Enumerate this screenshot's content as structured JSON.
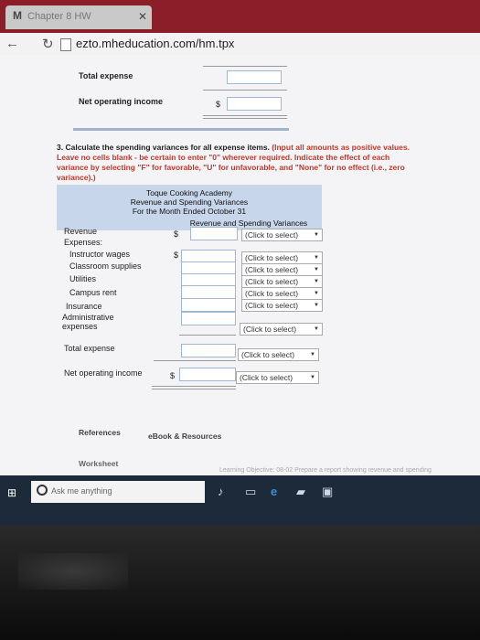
{
  "browser": {
    "tab_title": "Chapter 8 HW",
    "url": "ezto.mheducation.com/hm.tpx"
  },
  "top_section": {
    "total_expense_label": "Total expense",
    "net_operating_income_label": "Net operating income",
    "currency": "$"
  },
  "instructions": {
    "number": "3.",
    "text": "Calculate the spending variances for all expense items.",
    "note": "(Input all amounts as positive values. Leave no cells blank - be certain to enter \"0\" wherever required. Indicate the effect of each variance by selecting \"F\" for favorable, \"U\" for unfavorable, and \"None\" for no effect (i.e., zero variance).)"
  },
  "table": {
    "company": "Toque Cooking Academy",
    "report": "Revenue and Spending Variances",
    "period": "For the Month Ended October 31",
    "column_header": "Revenue and Spending Variances",
    "select_placeholder": "(Click to select)",
    "currency": "$",
    "revenue_label": "Revenue",
    "expenses_label": "Expenses:",
    "expense_rows": [
      {
        "label": "Instructor wages"
      },
      {
        "label": "Classroom supplies"
      },
      {
        "label": "Utilities"
      },
      {
        "label": "Campus rent"
      },
      {
        "label": "Insurance"
      },
      {
        "label": "Administrative expenses"
      }
    ],
    "total_expense_label": "Total expense",
    "net_operating_income_label": "Net operating income"
  },
  "footer": {
    "references_label": "References",
    "ebook_label": "eBook & Resources",
    "worksheet_label": "Worksheet",
    "learning_objective": "Learning Objective: 08-02 Prepare a report showing revenue and spending"
  },
  "taskbar": {
    "search_placeholder": "Ask me anything"
  }
}
